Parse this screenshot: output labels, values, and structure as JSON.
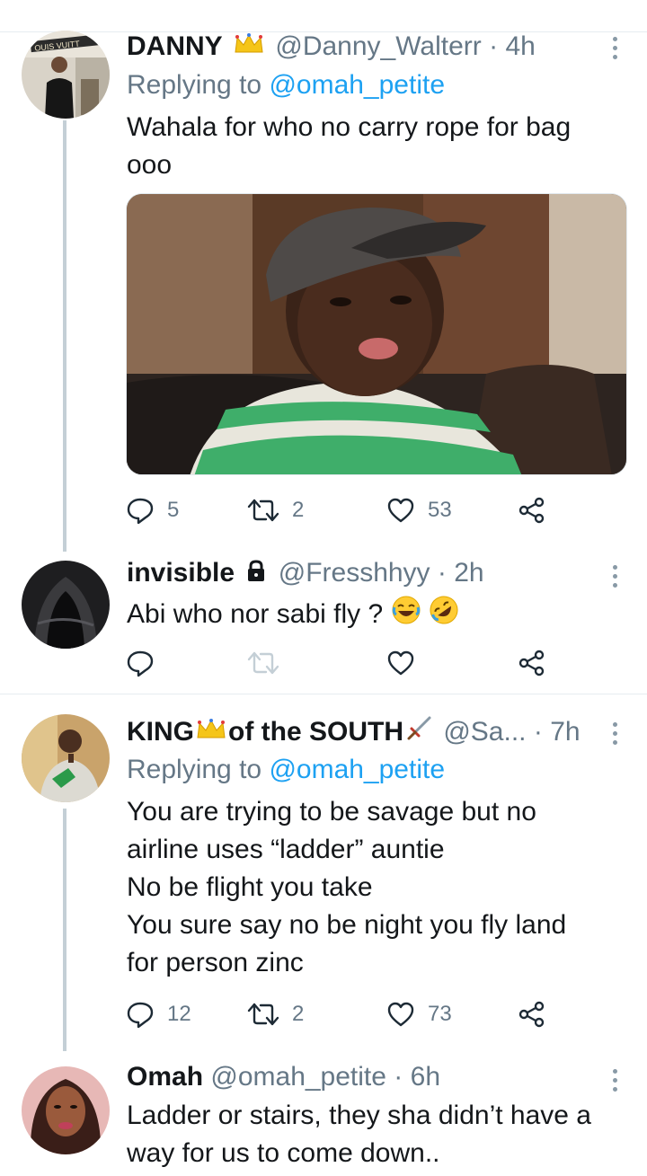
{
  "tweets": [
    {
      "name": "DANNY",
      "handle": "@Danny_Walterr",
      "separator": "·",
      "time": "4h",
      "replying_label": "Replying to",
      "replying_to": "@omah_petite",
      "text_lines": [
        "Wahala for who no carry rope for bag",
        "ooo"
      ],
      "has_media": true,
      "avatar_sign_text": "OUIS VUITT",
      "replies": "5",
      "retweets": "2",
      "likes": "53"
    },
    {
      "name": "invisible",
      "handle": "@Fresshhyy",
      "separator": "·",
      "time": "2h",
      "text_lines": [
        "Abi who nor sabi fly ?"
      ],
      "replies": "",
      "retweets": "",
      "likes": ""
    },
    {
      "name": "KING",
      "name_suffix": "of the SOUTH",
      "handle": "@Sa...",
      "separator": "·",
      "time": "7h",
      "replying_label": "Replying to",
      "replying_to": "@omah_petite",
      "text_lines": [
        "You are trying to be savage but no",
        "airline uses “ladder” auntie",
        "No be flight you take",
        "You sure say no be night you fly land",
        "for person zinc"
      ],
      "replies": "12",
      "retweets": "2",
      "likes": "73"
    },
    {
      "name": "Omah",
      "handle": "@omah_petite",
      "separator": "·",
      "time": "6h",
      "text_lines": [
        "Ladder or stairs, they sha didn’t have a",
        "way for us to come down.."
      ]
    }
  ],
  "colors": {
    "link": "#1da1f2",
    "muted": "#657786",
    "text": "#14171a",
    "thread_line": "#c4cfd6",
    "crown": "#f5c518"
  },
  "icons": [
    "reply-icon",
    "retweet-icon",
    "like-icon",
    "share-icon",
    "more-icon",
    "crown-icon",
    "lock-icon",
    "sword-icon",
    "laugh-emoji",
    "rofl-emoji"
  ]
}
